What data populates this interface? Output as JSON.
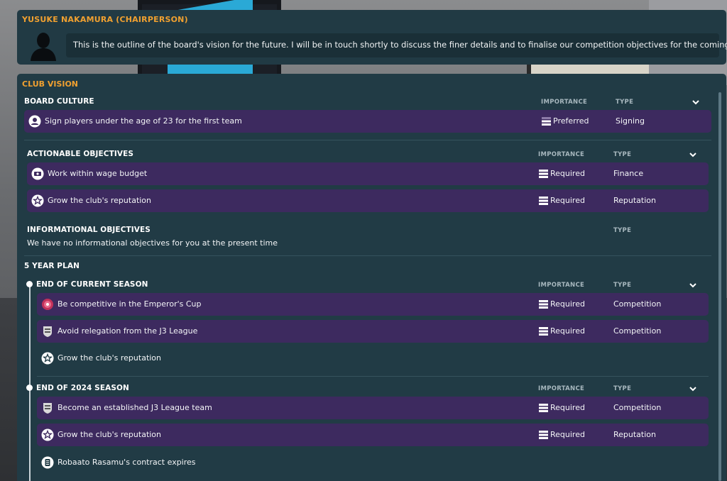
{
  "chairperson": {
    "name": "YUSUKE NAKAMURA (CHAIRPERSON)",
    "message": "This is the outline of the board's vision for the future. I will be in touch shortly to discuss the finer details and to finalise our competition objectives for the coming season."
  },
  "vision": {
    "title": "CLUB VISION",
    "board_culture": {
      "title": "BOARD CULTURE",
      "importance_header": "IMPORTANCE",
      "type_header": "TYPE",
      "items": [
        {
          "label": "Sign players under the age of 23 for the first team",
          "importance": "Preferred",
          "type": "Signing",
          "icon": "person-icon"
        }
      ]
    },
    "actionable": {
      "title": "ACTIONABLE OBJECTIVES",
      "importance_header": "IMPORTANCE",
      "type_header": "TYPE",
      "items": [
        {
          "label": "Work within wage budget",
          "importance": "Required",
          "type": "Finance",
          "icon": "wage-icon"
        },
        {
          "label": "Grow the club's reputation",
          "importance": "Required",
          "type": "Reputation",
          "icon": "star-icon"
        }
      ]
    },
    "informational": {
      "title": "INFORMATIONAL OBJECTIVES",
      "type_header": "TYPE",
      "empty_text": "We have no informational objectives for you at the present time"
    },
    "five_year_plan": {
      "title": "5 YEAR PLAN",
      "current_season": {
        "title": "END OF CURRENT SEASON",
        "importance_header": "IMPORTANCE",
        "type_header": "TYPE",
        "items": [
          {
            "label": "Be competitive in the Emperor's Cup",
            "importance": "Required",
            "type": "Competition",
            "icon": "emperors-cup-icon"
          },
          {
            "label": "Avoid relegation from the J3 League",
            "importance": "Required",
            "type": "Competition",
            "icon": "j3-league-icon"
          }
        ],
        "plain_item": {
          "label": "Grow the club's reputation",
          "icon": "star-icon"
        }
      },
      "season_2024": {
        "title": "END OF 2024 SEASON",
        "importance_header": "IMPORTANCE",
        "type_header": "TYPE",
        "items": [
          {
            "label": "Become an established J3 League team",
            "importance": "Required",
            "type": "Competition",
            "icon": "j3-league-icon"
          },
          {
            "label": "Grow the club's reputation",
            "importance": "Required",
            "type": "Reputation",
            "icon": "star-icon"
          }
        ],
        "plain_item": {
          "label": "Robaato Rasamu's contract expires",
          "icon": "contract-icon"
        }
      }
    }
  },
  "colors": {
    "accent": "#f0a030",
    "panel": "#213b45",
    "row": "#3d2a5f"
  }
}
